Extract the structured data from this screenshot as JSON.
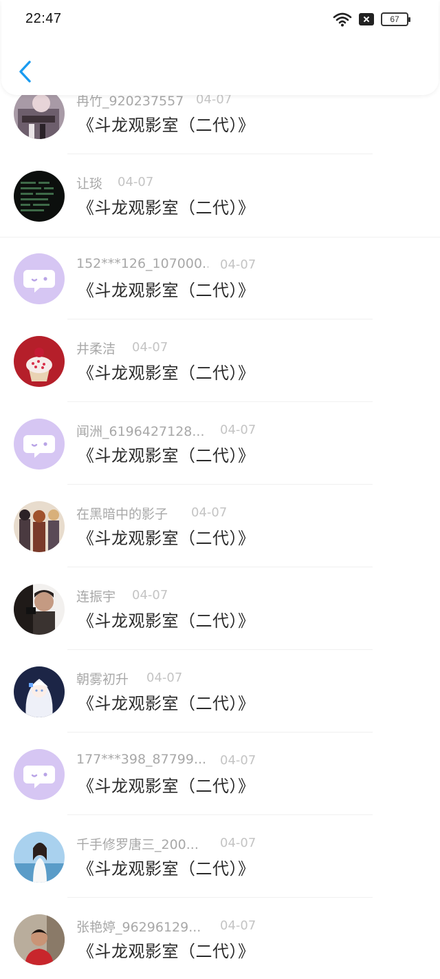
{
  "status_bar": {
    "time": "22:47",
    "battery": "67"
  },
  "colors": {
    "accent": "#1a9bf0",
    "avatar_default": "#d6c6f3"
  },
  "items": [
    {
      "name": "冉竹_920237557",
      "date": "04-07",
      "message": "《斗龙观影室（二代）》",
      "avatar": "anime-girl-avatar"
    },
    {
      "name": "让琰",
      "date": "04-07",
      "message": "《斗龙观影室（二代）》",
      "avatar": "dark-screen-avatar"
    },
    {
      "name": "152***126_107000...",
      "date": "04-07",
      "message": "《斗龙观影室（二代）》",
      "avatar": "default-chat-avatar"
    },
    {
      "name": "井柔洁",
      "date": "04-07",
      "message": "《斗龙观影室（二代）》",
      "avatar": "cupcake-avatar"
    },
    {
      "name": "闻洲_6196427128...",
      "date": "04-07",
      "message": "《斗龙观影室（二代）》",
      "avatar": "default-chat-avatar"
    },
    {
      "name": "在黑暗中的影子",
      "date": "04-07",
      "message": "《斗龙观影室（二代）》",
      "avatar": "anime-group-avatar"
    },
    {
      "name": "连振宇",
      "date": "04-07",
      "message": "《斗龙观影室（二代）》",
      "avatar": "photo-boy-avatar"
    },
    {
      "name": "朝雾初升",
      "date": "04-07",
      "message": "《斗龙观影室（二代）》",
      "avatar": "white-hair-anime-avatar"
    },
    {
      "name": "177***398_87799...",
      "date": "04-07",
      "message": "《斗龙观影室（二代）》",
      "avatar": "default-chat-avatar"
    },
    {
      "name": "千手修罗唐三_200...",
      "date": "04-07",
      "message": "《斗龙观影室（二代）》",
      "avatar": "girl-beach-avatar"
    },
    {
      "name": "张艳婷_96296129...",
      "date": "04-07",
      "message": "《斗龙观影室（二代）》",
      "avatar": "child-photo-avatar"
    }
  ]
}
